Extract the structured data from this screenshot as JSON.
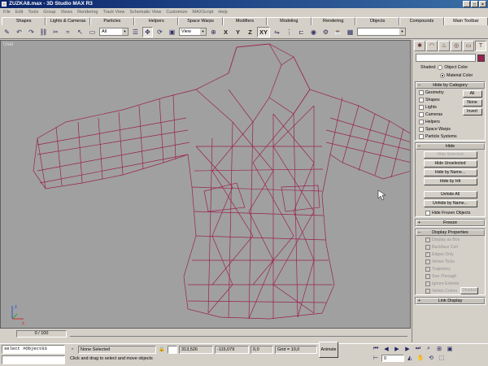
{
  "titlebar": {
    "title": "ZUZKA8.max - 3D Studio MAX R3",
    "controls": [
      "_",
      "□",
      "×"
    ]
  },
  "menubar": {
    "items": [
      "File",
      "Edit",
      "Tools",
      "Group",
      "Views",
      "Rendering",
      "Track View",
      "Schematic View",
      "Customize",
      "MAXScript",
      "Help"
    ]
  },
  "tabs": {
    "items": [
      "Shapes",
      "Lights & Cameras",
      "Particles",
      "Helpers",
      "Space Warps",
      "Modifiers",
      "Modeling",
      "Rendering",
      "Objects",
      "Compounds",
      "Main Toolbar"
    ],
    "active": "Main Toolbar"
  },
  "toolbar": {
    "selection_filter": "All",
    "coord_system": "View",
    "axis_labels": [
      "X",
      "Y",
      "Z",
      "XY"
    ]
  },
  "viewport": {
    "label": "User",
    "mesh_color": "#99224e"
  },
  "panel": {
    "shaded_label": "Shaded:",
    "object_color": "Object Color",
    "material_color": "Material Color",
    "hide_by_category": {
      "title": "Hide by Category",
      "items": [
        "Geometry",
        "Shapes",
        "Lights",
        "Cameras",
        "Helpers",
        "Space Warps",
        "Particle Systems"
      ],
      "buttons": [
        "All",
        "None",
        "Invert"
      ]
    },
    "hide": {
      "title": "Hide",
      "buttons": [
        "Hide Selected",
        "Hide Unselected",
        "Hide by Name...",
        "Hide by Hit",
        "Unhide All",
        "Unhide by Name..."
      ],
      "hide_frozen": "Hide Frozen Objects"
    },
    "freeze": {
      "title": "Freeze"
    },
    "display_properties": {
      "title": "Display Properties",
      "items": [
        "Display as Box",
        "Backface Cull",
        "Edges Only",
        "Vertex Ticks",
        "Trajectory",
        "See-Through",
        "Ignore Extents",
        "Vertex Colors"
      ],
      "shaded_btn": "Shaded"
    },
    "link_display": {
      "title": "Link Display"
    }
  },
  "timebar": {
    "slider": "0 / 100"
  },
  "statusbar": {
    "script": "select #Object03",
    "selection": "None Selected",
    "coord_x": "313,526",
    "coord_y": "-115,079",
    "coord_z": "0,0",
    "grid": "Grid = 10,0",
    "animate": "Animate",
    "frame": "0",
    "prompt": "Click and drag to select and move objects"
  }
}
